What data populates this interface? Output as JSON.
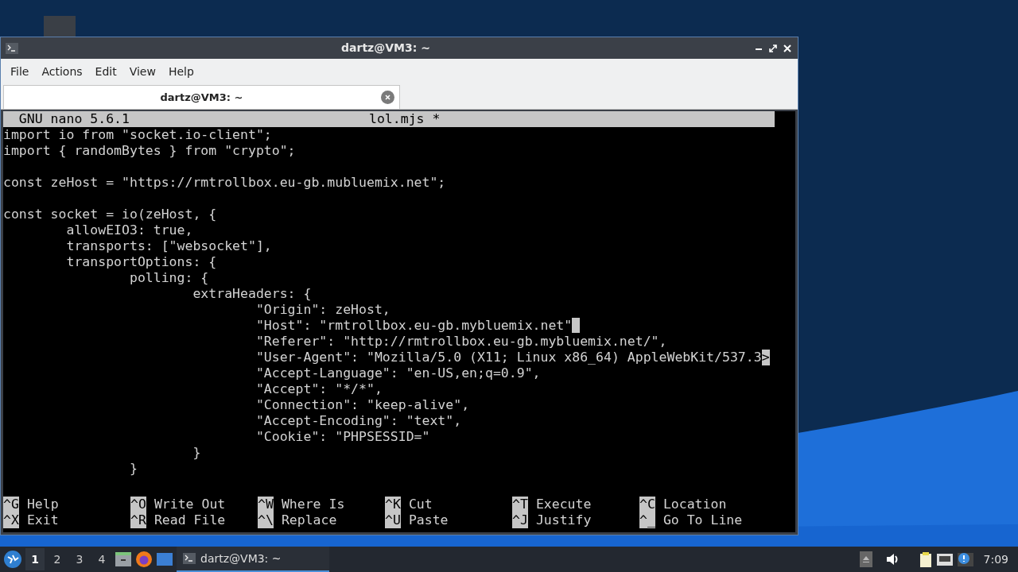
{
  "window": {
    "title": "dartz@VM3: ~"
  },
  "menu": [
    "File",
    "Actions",
    "Edit",
    "View",
    "Help"
  ],
  "tabs": [
    {
      "label": "dartz@VM3: ~",
      "selected": true
    }
  ],
  "nano": {
    "header": {
      "version": "GNU nano 5.6.1",
      "file": "lol.mjs *"
    },
    "lines": [
      {
        "kind": "code",
        "text": "import io from \"socket.io-client\";"
      },
      {
        "kind": "code",
        "text": "import { randomBytes } from \"crypto\";"
      },
      {
        "kind": "blank"
      },
      {
        "kind": "code",
        "text": "const zeHost = \"https://rmtrollbox.eu-gb.mubluemix.net\";"
      },
      {
        "kind": "blank"
      },
      {
        "kind": "code",
        "text": "const socket = io(zeHost, {"
      },
      {
        "kind": "code",
        "text": "        allowEIO3: true,"
      },
      {
        "kind": "code",
        "text": "        transports: [\"websocket\"],"
      },
      {
        "kind": "code",
        "text": "        transportOptions: {"
      },
      {
        "kind": "code",
        "text": "                polling: {"
      },
      {
        "kind": "code",
        "text": "                        extraHeaders: {"
      },
      {
        "kind": "code",
        "text": "                                \"Origin\": zeHost,"
      },
      {
        "kind": "code",
        "text": "                                \"Host\": \"rmtrollbox.eu-gb.mybluemix.net\"",
        "cursor": true
      },
      {
        "kind": "code",
        "text": "                                \"Referer\": \"http://rmtrollbox.eu-gb.mybluemix.net/\","
      },
      {
        "kind": "code",
        "text": "                                \"User-Agent\": \"Mozilla/5.0 (X11; Linux x86_64) AppleWebKit/537.3",
        "more_mark": ">"
      },
      {
        "kind": "code",
        "text": "                                \"Accept-Language\": \"en-US,en;q=0.9\","
      },
      {
        "kind": "code",
        "text": "                                \"Accept\": \"*/*\","
      },
      {
        "kind": "code",
        "text": "                                \"Connection\": \"keep-alive\","
      },
      {
        "kind": "code",
        "text": "                                \"Accept-Encoding\": \"text\","
      },
      {
        "kind": "code",
        "text": "                                \"Cookie\": \"PHPSESSID=\""
      },
      {
        "kind": "code",
        "text": "                        }"
      },
      {
        "kind": "code",
        "text": "                }"
      },
      {
        "kind": "blank"
      }
    ],
    "shortcuts": [
      {
        "key": "^G",
        "label": "Help"
      },
      {
        "key": "^O",
        "label": "Write Out"
      },
      {
        "key": "^W",
        "label": "Where Is"
      },
      {
        "key": "^K",
        "label": "Cut"
      },
      {
        "key": "^T",
        "label": "Execute"
      },
      {
        "key": "^C",
        "label": "Location"
      },
      {
        "key": "^X",
        "label": "Exit"
      },
      {
        "key": "^R",
        "label": "Read File"
      },
      {
        "key": "^\\",
        "label": "Replace"
      },
      {
        "key": "^U",
        "label": "Paste"
      },
      {
        "key": "^J",
        "label": "Justify"
      },
      {
        "key": "^_",
        "label": "Go To Line"
      }
    ]
  },
  "taskbar": {
    "desktops": [
      {
        "label": "1",
        "selected": true
      },
      {
        "label": "2",
        "selected": false
      },
      {
        "label": "3",
        "selected": false
      },
      {
        "label": "4",
        "selected": false
      }
    ],
    "tasks": [
      {
        "label": "dartz@VM3: ~",
        "selected": true
      }
    ],
    "clock": "7:09"
  }
}
